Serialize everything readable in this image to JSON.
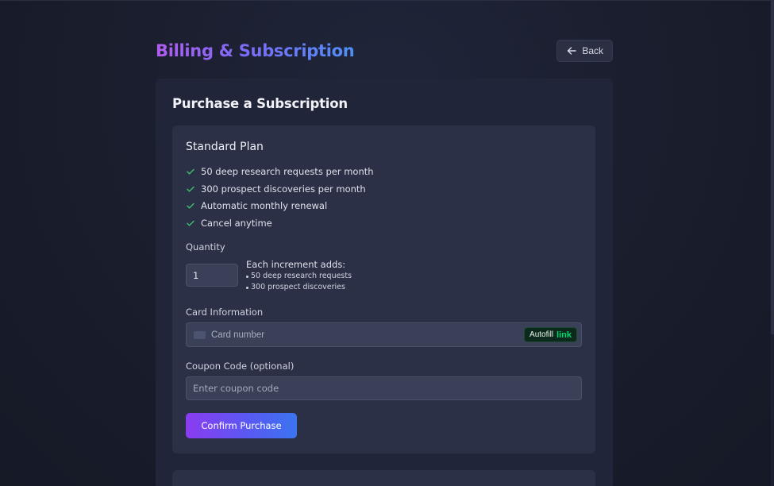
{
  "header": {
    "title": "Billing & Subscription",
    "back_label": "Back"
  },
  "purchase": {
    "section_title": "Purchase a Subscription",
    "plan": {
      "name": "Standard Plan",
      "features": [
        "50 deep research requests per month",
        "300 prospect discoveries per month",
        "Automatic monthly renewal",
        "Cancel anytime"
      ]
    },
    "quantity": {
      "label": "Quantity",
      "value": "1",
      "increment_title": "Each increment adds:",
      "increment_items": [
        "50 deep research requests",
        "300 prospect discoveries"
      ]
    },
    "card": {
      "label": "Card Information",
      "placeholder": "Card number",
      "autofill_label": "Autofill",
      "autofill_link": "link"
    },
    "coupon": {
      "label": "Coupon Code (optional)",
      "placeholder": "Enter coupon code"
    },
    "confirm_label": "Confirm Purchase"
  },
  "colors": {
    "background": "#1a1e2d",
    "card": "#20253a",
    "panel": "#2b3047",
    "accent_start": "#8b3cf0",
    "accent_end": "#3b74f0",
    "check": "#3fbf6a",
    "link_green": "#00d66f"
  }
}
